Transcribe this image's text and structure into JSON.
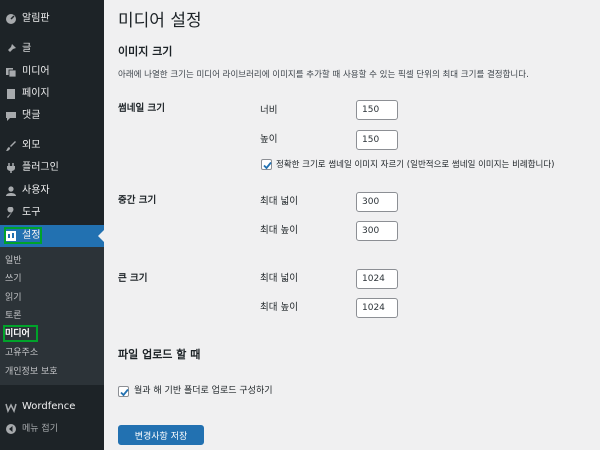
{
  "sidebar": {
    "items": [
      {
        "name": "dashboard",
        "label": "알림판",
        "icon": "dashboard-icon"
      },
      {
        "name": "posts",
        "label": "글",
        "icon": "pin-icon"
      },
      {
        "name": "media",
        "label": "미디어",
        "icon": "media-icon"
      },
      {
        "name": "pages",
        "label": "페이지",
        "icon": "page-icon"
      },
      {
        "name": "comments",
        "label": "댓글",
        "icon": "comment-icon"
      },
      {
        "name": "appearance",
        "label": "외모",
        "icon": "brush-icon"
      },
      {
        "name": "plugins",
        "label": "플러그인",
        "icon": "plugin-icon"
      },
      {
        "name": "users",
        "label": "사용자",
        "icon": "user-icon"
      },
      {
        "name": "tools",
        "label": "도구",
        "icon": "wrench-icon"
      },
      {
        "name": "settings",
        "label": "설정",
        "icon": "settings-icon"
      },
      {
        "name": "wordfence",
        "label": "Wordfence",
        "icon": "wordfence-icon"
      },
      {
        "name": "collapse",
        "label": "메뉴 접기",
        "icon": "collapse-icon"
      }
    ],
    "submenu": [
      "일반",
      "쓰기",
      "읽기",
      "토론",
      "미디어",
      "고유주소",
      "개인정보 보호"
    ]
  },
  "page": {
    "title": "미디어 설정",
    "image_sizes_title": "이미지 크기",
    "image_sizes_desc": "아래에 나열한 크기는 미디어 라이브러리에 이미지를 추가할 때 사용할 수 있는 픽셀 단위의 최대 크기를 결정합니다.",
    "thumbnail": {
      "label": "썸네일 크기",
      "width_label": "너비",
      "width": "150",
      "height_label": "높이",
      "height": "150",
      "crop_label": "정확한 크기로 썸네일 이미지 자르기 (일반적으로 썸네일 이미지는 비례합니다)"
    },
    "medium": {
      "label": "중간 크기",
      "width_label": "최대 넓이",
      "width": "300",
      "height_label": "최대 높이",
      "height": "300"
    },
    "large": {
      "label": "큰 크기",
      "width_label": "최대 넓이",
      "width": "1024",
      "height_label": "최대 높이",
      "height": "1024"
    },
    "uploads_title": "파일 업로드 할 때",
    "uploads_checkbox": "월과 해 기반 폴더로 업로드 구성하기",
    "save_label": "변경사항 저장"
  },
  "colors": {
    "accent": "#2271b1",
    "sidebar": "#1d2327",
    "highlight": "#00a32a"
  }
}
